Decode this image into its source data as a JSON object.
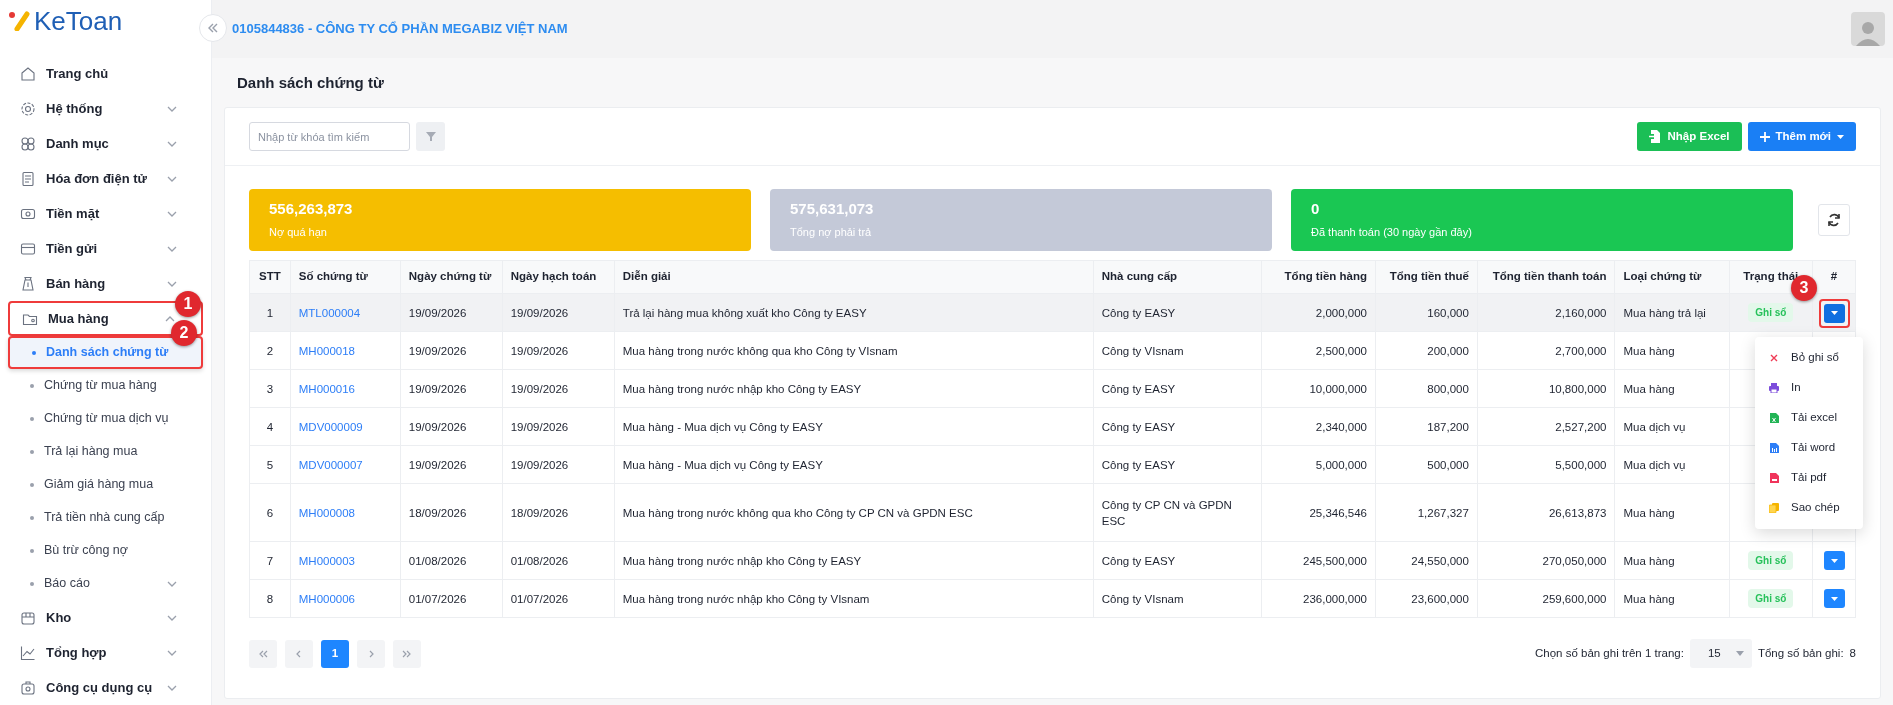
{
  "app": {
    "logo": "KeToan",
    "company": "0105844836 - CÔNG TY CỔ PHẦN MEGABIZ VIỆT NAM"
  },
  "sidebar": {
    "items": [
      {
        "label": "Trang chủ"
      },
      {
        "label": "Hệ thống",
        "expanded": false
      },
      {
        "label": "Danh mục",
        "expanded": false
      },
      {
        "label": "Hóa đơn điện tử",
        "expanded": false
      },
      {
        "label": "Tiền mặt",
        "expanded": false
      },
      {
        "label": "Tiền gửi",
        "expanded": false
      },
      {
        "label": "Bán hàng",
        "expanded": false
      },
      {
        "label": "Mua hàng",
        "expanded": true,
        "annotation": "1",
        "children": [
          {
            "label": "Danh sách chứng từ",
            "selected": true,
            "annotation": "2"
          },
          {
            "label": "Chứng từ mua hàng",
            "selected": false
          },
          {
            "label": "Chứng từ mua dịch vụ",
            "selected": false
          },
          {
            "label": "Trả lại hàng mua",
            "selected": false
          },
          {
            "label": "Giảm giá hàng mua",
            "selected": false
          },
          {
            "label": "Trả tiền nhà cung cấp",
            "selected": false
          },
          {
            "label": "Bù trừ công nợ",
            "selected": false
          },
          {
            "label": "Báo cáo",
            "selected": false,
            "expanded": false
          }
        ]
      },
      {
        "label": "Kho",
        "expanded": false
      },
      {
        "label": "Tổng hợp",
        "expanded": false
      },
      {
        "label": "Công cụ dụng cụ",
        "expanded": false
      }
    ]
  },
  "page_title": "Danh sách chứng từ",
  "toolbar": {
    "search": {
      "placeholder": "Nhập từ khóa tìm kiếm"
    },
    "buttons": [
      {
        "label": "Nhập Excel",
        "kind": "excel"
      },
      {
        "label": "Thêm mới",
        "kind": "add"
      }
    ]
  },
  "summary_cards": [
    {
      "value": "556,263,873",
      "label": "Nợ quá hạn",
      "color": "#f5be00"
    },
    {
      "value": "575,631,073",
      "label": "Tổng nợ phải trả",
      "color": "#c4c9d8"
    },
    {
      "value": "0",
      "label": "Đã thanh toán (30 ngày gần đây)",
      "color": "#1ac753"
    }
  ],
  "table": {
    "columns": [
      "STT",
      "Số chứng từ",
      "Ngày chứng từ",
      "Ngày hạch toán",
      "Diễn giải",
      "Nhà cung cấp",
      "Tổng tiền hàng",
      "Tổng tiền thuế",
      "Tổng tiền thanh toán",
      "Loại chứng từ",
      "Trạng thái",
      "#"
    ],
    "rows": [
      {
        "cells": [
          "1",
          "MTL000004",
          "19/09/2026",
          "19/09/2026",
          "Trả lại hàng mua không xuất kho Công ty EASY",
          "Công ty EASY",
          "2,000,000",
          "160,000",
          "2,160,000",
          "Mua hàng trả lại"
        ],
        "status": "Ghi sổ",
        "action_annotation": "3",
        "highlighted": true
      },
      {
        "cells": [
          "2",
          "MH000018",
          "19/09/2026",
          "19/09/2026",
          "Mua hàng trong nước không qua kho Công ty VIsnam",
          "Công ty VIsnam",
          "2,500,000",
          "200,000",
          "2,700,000",
          "Mua hàng"
        ],
        "highlighted": false
      },
      {
        "cells": [
          "3",
          "MH000016",
          "19/09/2026",
          "19/09/2026",
          "Mua hàng trong nước nhập kho Công ty EASY",
          "Công ty EASY",
          "10,000,000",
          "800,000",
          "10,800,000",
          "Mua hàng"
        ],
        "highlighted": false
      },
      {
        "cells": [
          "4",
          "MDV000009",
          "19/09/2026",
          "19/09/2026",
          "Mua hàng - Mua dịch vụ Công ty EASY",
          "Công ty EASY",
          "2,340,000",
          "187,200",
          "2,527,200",
          "Mua dịch vụ"
        ],
        "highlighted": false
      },
      {
        "cells": [
          "5",
          "MDV000007",
          "19/09/2026",
          "19/09/2026",
          "Mua hàng - Mua dịch vụ Công ty EASY",
          "Công ty EASY",
          "5,000,000",
          "500,000",
          "5,500,000",
          "Mua dịch vụ"
        ],
        "highlighted": false
      },
      {
        "cells": [
          "6",
          "MH000008",
          "18/09/2026",
          "18/09/2026",
          "Mua hàng trong nước không qua kho Công ty CP CN và GPDN ESC",
          "Công ty CP CN và GPDN ESC",
          "25,346,546",
          "1,267,327",
          "26,613,873",
          "Mua hàng"
        ],
        "highlighted": false
      },
      {
        "cells": [
          "7",
          "MH000003",
          "01/08/2026",
          "01/08/2026",
          "Mua hàng trong nước nhập kho Công ty EASY",
          "Công ty EASY",
          "245,500,000",
          "24,550,000",
          "270,050,000",
          "Mua hàng"
        ],
        "status": "Ghi sổ",
        "highlighted": false
      },
      {
        "cells": [
          "8",
          "MH000006",
          "01/07/2026",
          "01/07/2026",
          "Mua hàng trong nước nhập kho Công ty VIsnam",
          "Công ty VIsnam",
          "236,000,000",
          "23,600,000",
          "259,600,000",
          "Mua hàng"
        ],
        "status": "Ghi sổ",
        "highlighted": false
      }
    ]
  },
  "action_menu": [
    {
      "label": "Bỏ ghi sổ",
      "kind": "unpost"
    },
    {
      "label": "In",
      "kind": "print"
    },
    {
      "label": "Tải excel",
      "kind": "excel"
    },
    {
      "label": "Tải word",
      "kind": "word"
    },
    {
      "label": "Tải pdf",
      "kind": "pdf"
    },
    {
      "label": "Sao chép",
      "kind": "copy"
    }
  ],
  "pagination": {
    "pages": [
      {
        "label": "1",
        "selected": true
      }
    ],
    "page_size_label": "Chọn số bản ghi trên 1 trang:",
    "page_size": "15",
    "total_label": "Tổng số bản ghi:",
    "total": "8"
  }
}
